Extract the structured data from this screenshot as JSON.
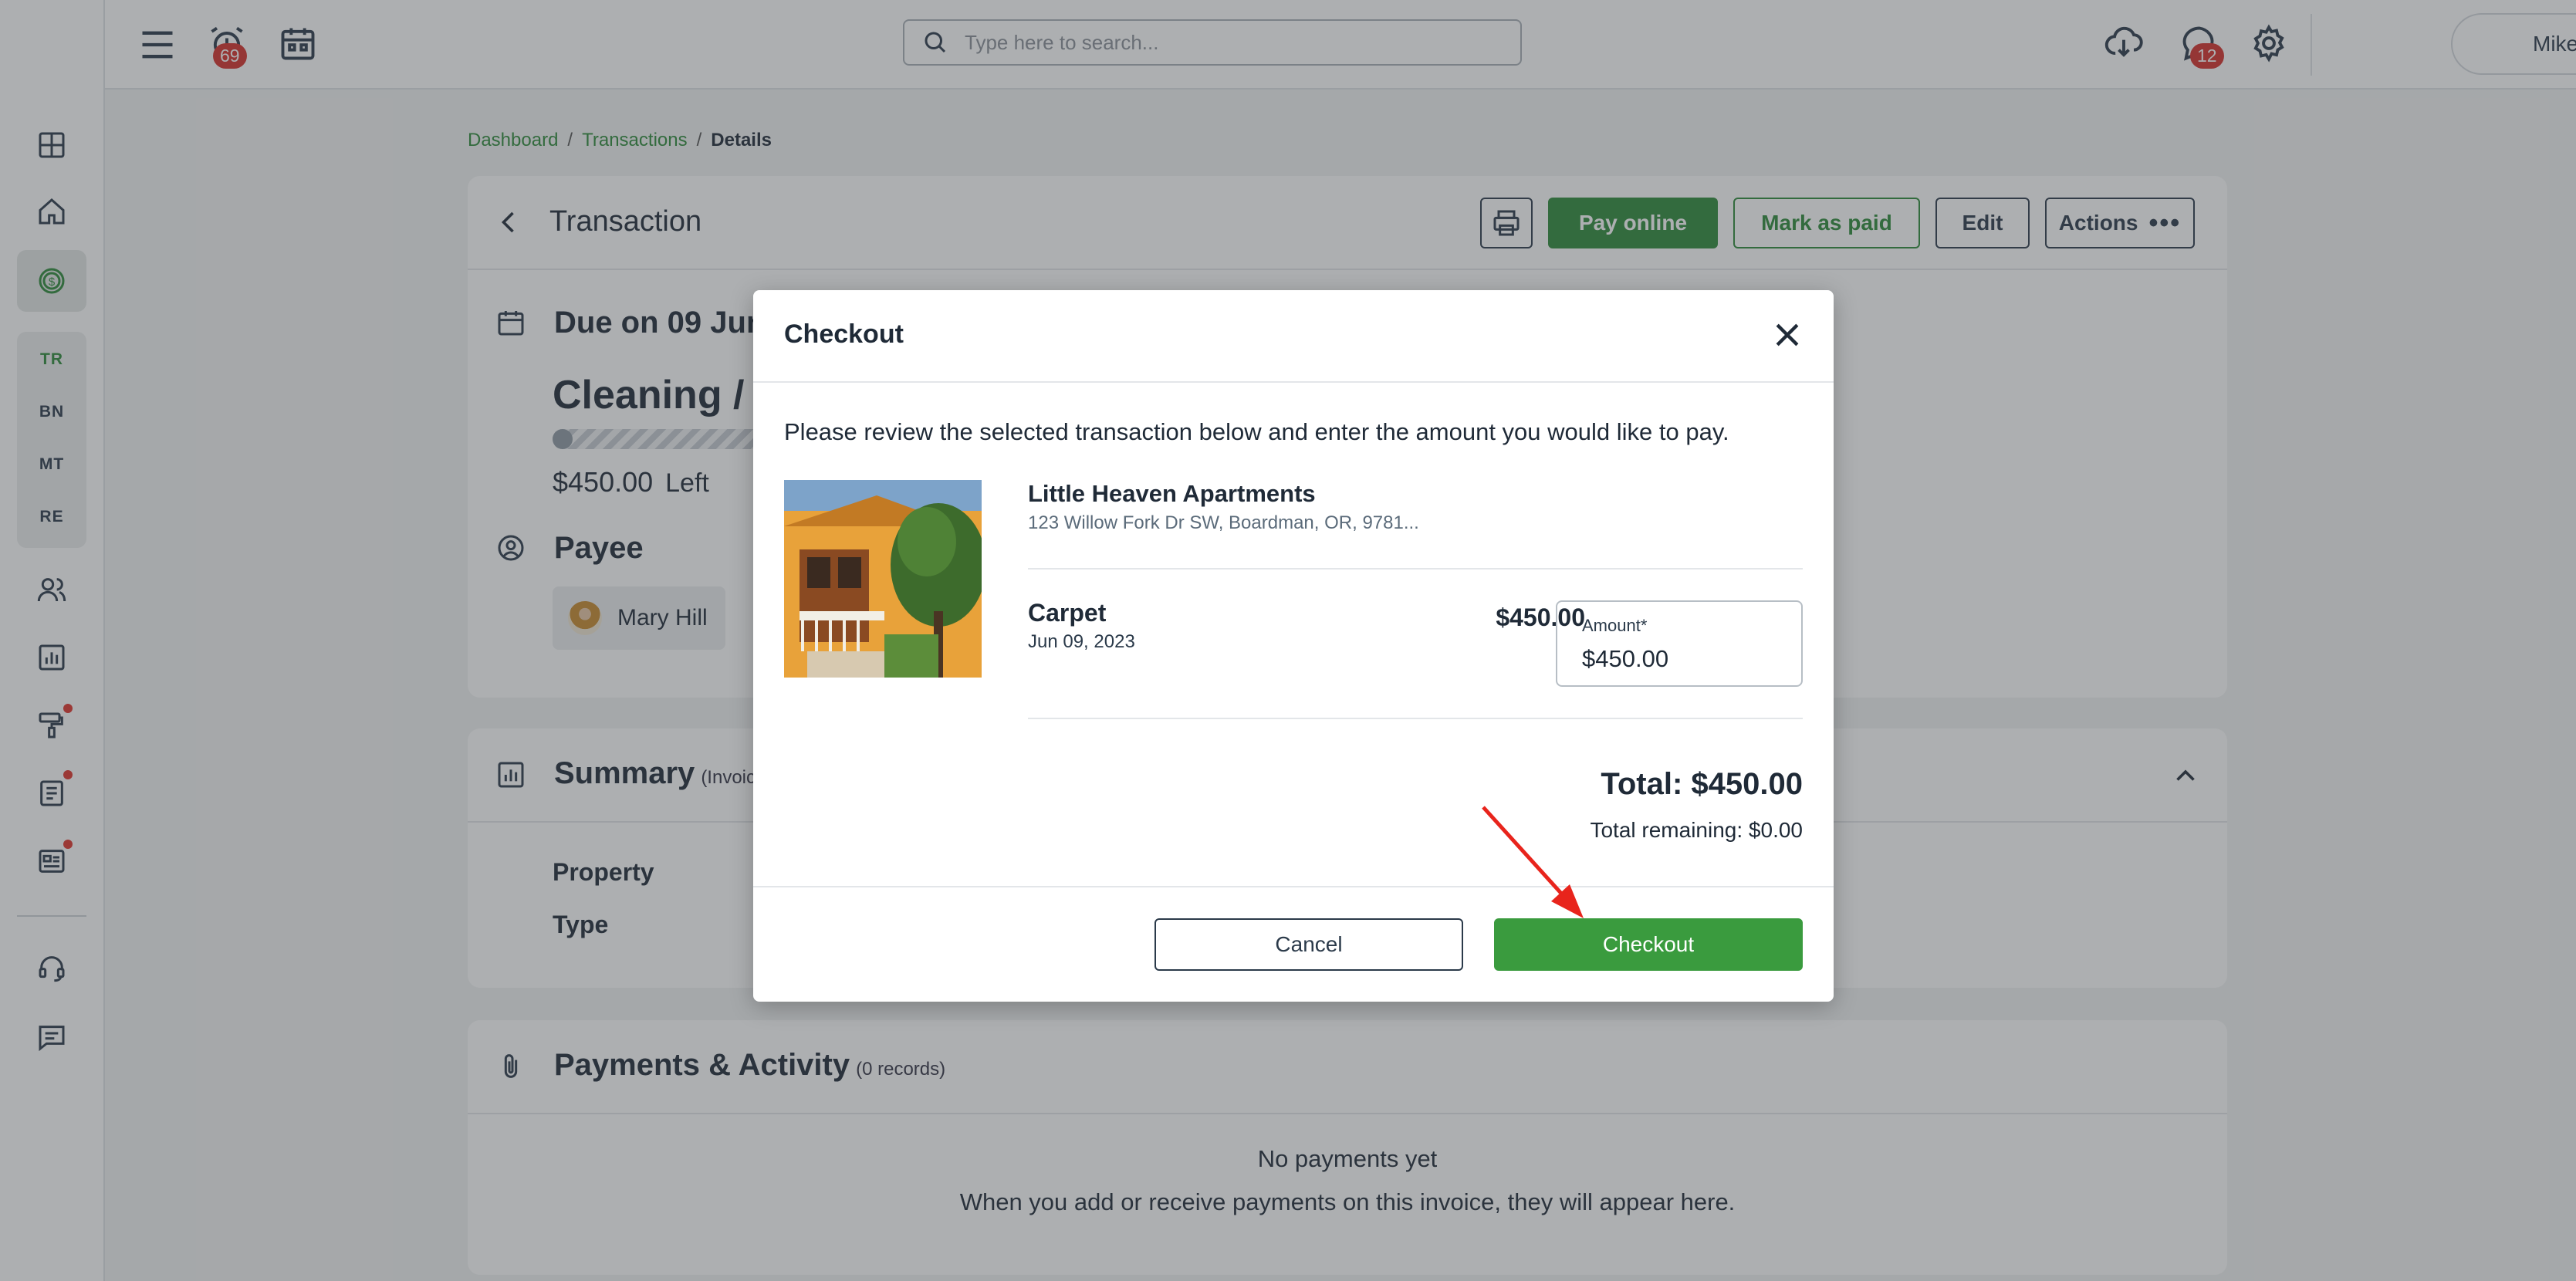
{
  "topbar": {
    "search_placeholder": "Type here to search...",
    "alarm_badge": "69",
    "chat_badge": "12",
    "user_name": "Mike"
  },
  "sidebar": {
    "items": [
      {
        "icon": "dashboard-grid-icon"
      },
      {
        "icon": "home-icon"
      },
      {
        "icon": "dollar-circle-icon",
        "active": true
      },
      {
        "text": "TR",
        "active": true
      },
      {
        "text": "BN"
      },
      {
        "text": "MT"
      },
      {
        "text": "RE"
      },
      {
        "icon": "people-icon"
      },
      {
        "icon": "bar-chart-icon"
      },
      {
        "icon": "paint-roller-icon",
        "dot": true
      },
      {
        "icon": "document-icon",
        "dot": true
      },
      {
        "icon": "news-icon",
        "dot": true
      },
      {
        "icon": "headset-icon"
      },
      {
        "icon": "message-icon"
      }
    ]
  },
  "breadcrumb": {
    "items": [
      "Dashboard",
      "Transactions",
      "Details"
    ],
    "separator": "/"
  },
  "transaction": {
    "title": "Transaction",
    "buttons": {
      "pay_online": "Pay online",
      "mark_as_paid": "Mark as paid",
      "edit": "Edit",
      "actions": "Actions"
    },
    "due": "Due on 09 Jun",
    "category": "Cleaning / C",
    "progress_fraction": 0.0,
    "amount_left": "$450.00",
    "left_label": "Left",
    "payee_label": "Payee",
    "payee_name": "Mary Hill"
  },
  "summary": {
    "title": "Summary",
    "subtitle": "(Invoice",
    "rows": [
      "Property",
      "Type"
    ]
  },
  "payments": {
    "title": "Payments & Activity",
    "count": "(0 records)",
    "empty_title": "No payments yet",
    "empty_text": "When you add or receive payments on this invoice, they will appear here."
  },
  "modal": {
    "title": "Checkout",
    "description": "Please review the selected transaction below and enter the amount you would like to pay.",
    "property_name": "Little Heaven Apartments",
    "property_address": "123 Willow Fork Dr SW, Boardman, OR, 9781...",
    "item_name": "Carpet",
    "item_date": "Jun 09, 2023",
    "item_price": "$450.00",
    "amount_label": "Amount*",
    "amount_value": "$450.00",
    "total": "Total: $450.00",
    "remaining": "Total remaining: $0.00",
    "cancel": "Cancel",
    "checkout": "Checkout"
  },
  "colors": {
    "brand_green": "#2e8b3a",
    "badge_red": "#d6302a",
    "annotation_arrow": "#e8241c"
  }
}
